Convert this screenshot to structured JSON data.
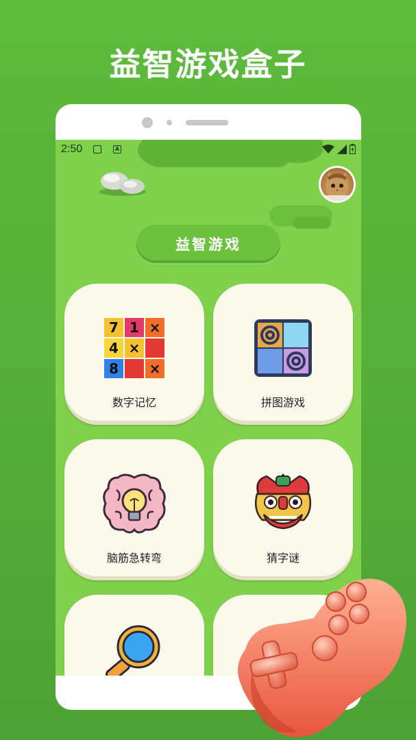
{
  "promo": {
    "headline": "益智游戏盒子"
  },
  "status_bar": {
    "time": "2:50",
    "icons": [
      "image-icon",
      "a-letter-icon",
      "wifi-icon",
      "signal-icon",
      "battery-icon"
    ]
  },
  "header": {
    "title": "益智游戏"
  },
  "games": [
    {
      "label": "数字记忆",
      "icon": "number-grid-icon"
    },
    {
      "label": "拼图游戏",
      "icon": "puzzle-tiles-icon"
    },
    {
      "label": "脑筋急转弯",
      "icon": "brain-bulb-icon"
    },
    {
      "label": "猜字谜",
      "icon": "lion-dance-icon"
    },
    {
      "label": "",
      "icon": "magnifier-icon"
    },
    {
      "label": "",
      "icon": ""
    }
  ],
  "number_grid": [
    "7",
    "1",
    "×",
    "4",
    "×",
    "",
    "8",
    "",
    "×"
  ],
  "colors": {
    "background": "#5dbb3c",
    "screen": "#7fd04b",
    "card": "#fbf8ec",
    "pill": "#6cc13f"
  }
}
